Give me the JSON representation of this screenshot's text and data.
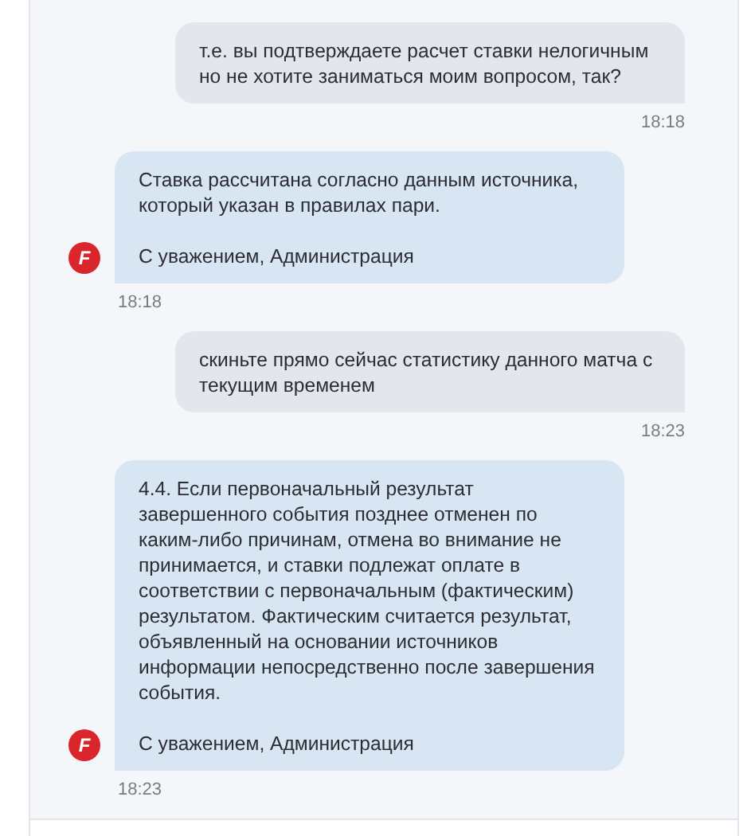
{
  "messages": [
    {
      "kind": "outgoing",
      "paragraphs": [
        "т.е. вы подтверждаете расчет ставки нелогичным но не хотите заниматься моим вопросом, так?"
      ],
      "time": "18:18"
    },
    {
      "kind": "incoming",
      "avatar": "F",
      "paragraphs": [
        "Ставка рассчитана согласно данным источника, который указан в правилах пари.",
        "С уважением, Администрация"
      ],
      "time": "18:18"
    },
    {
      "kind": "outgoing",
      "paragraphs": [
        "скиньте прямо сейчас статистику данного матча с текущим временем"
      ],
      "time": "18:23"
    },
    {
      "kind": "incoming",
      "avatar": "F",
      "paragraphs": [
        "4.4. Если первоначальный результат завершенного события позднее отменен по каким-либо причинам, отмена во внимание не принимается, и ставки подлежат оплате в соответствии с первоначальным (фактическим) результатом. Фактическим считается результат, объявленный на основании источников информации непосредственно после завершения события.",
        "С уважением, Администрация"
      ],
      "time": "18:23"
    }
  ]
}
